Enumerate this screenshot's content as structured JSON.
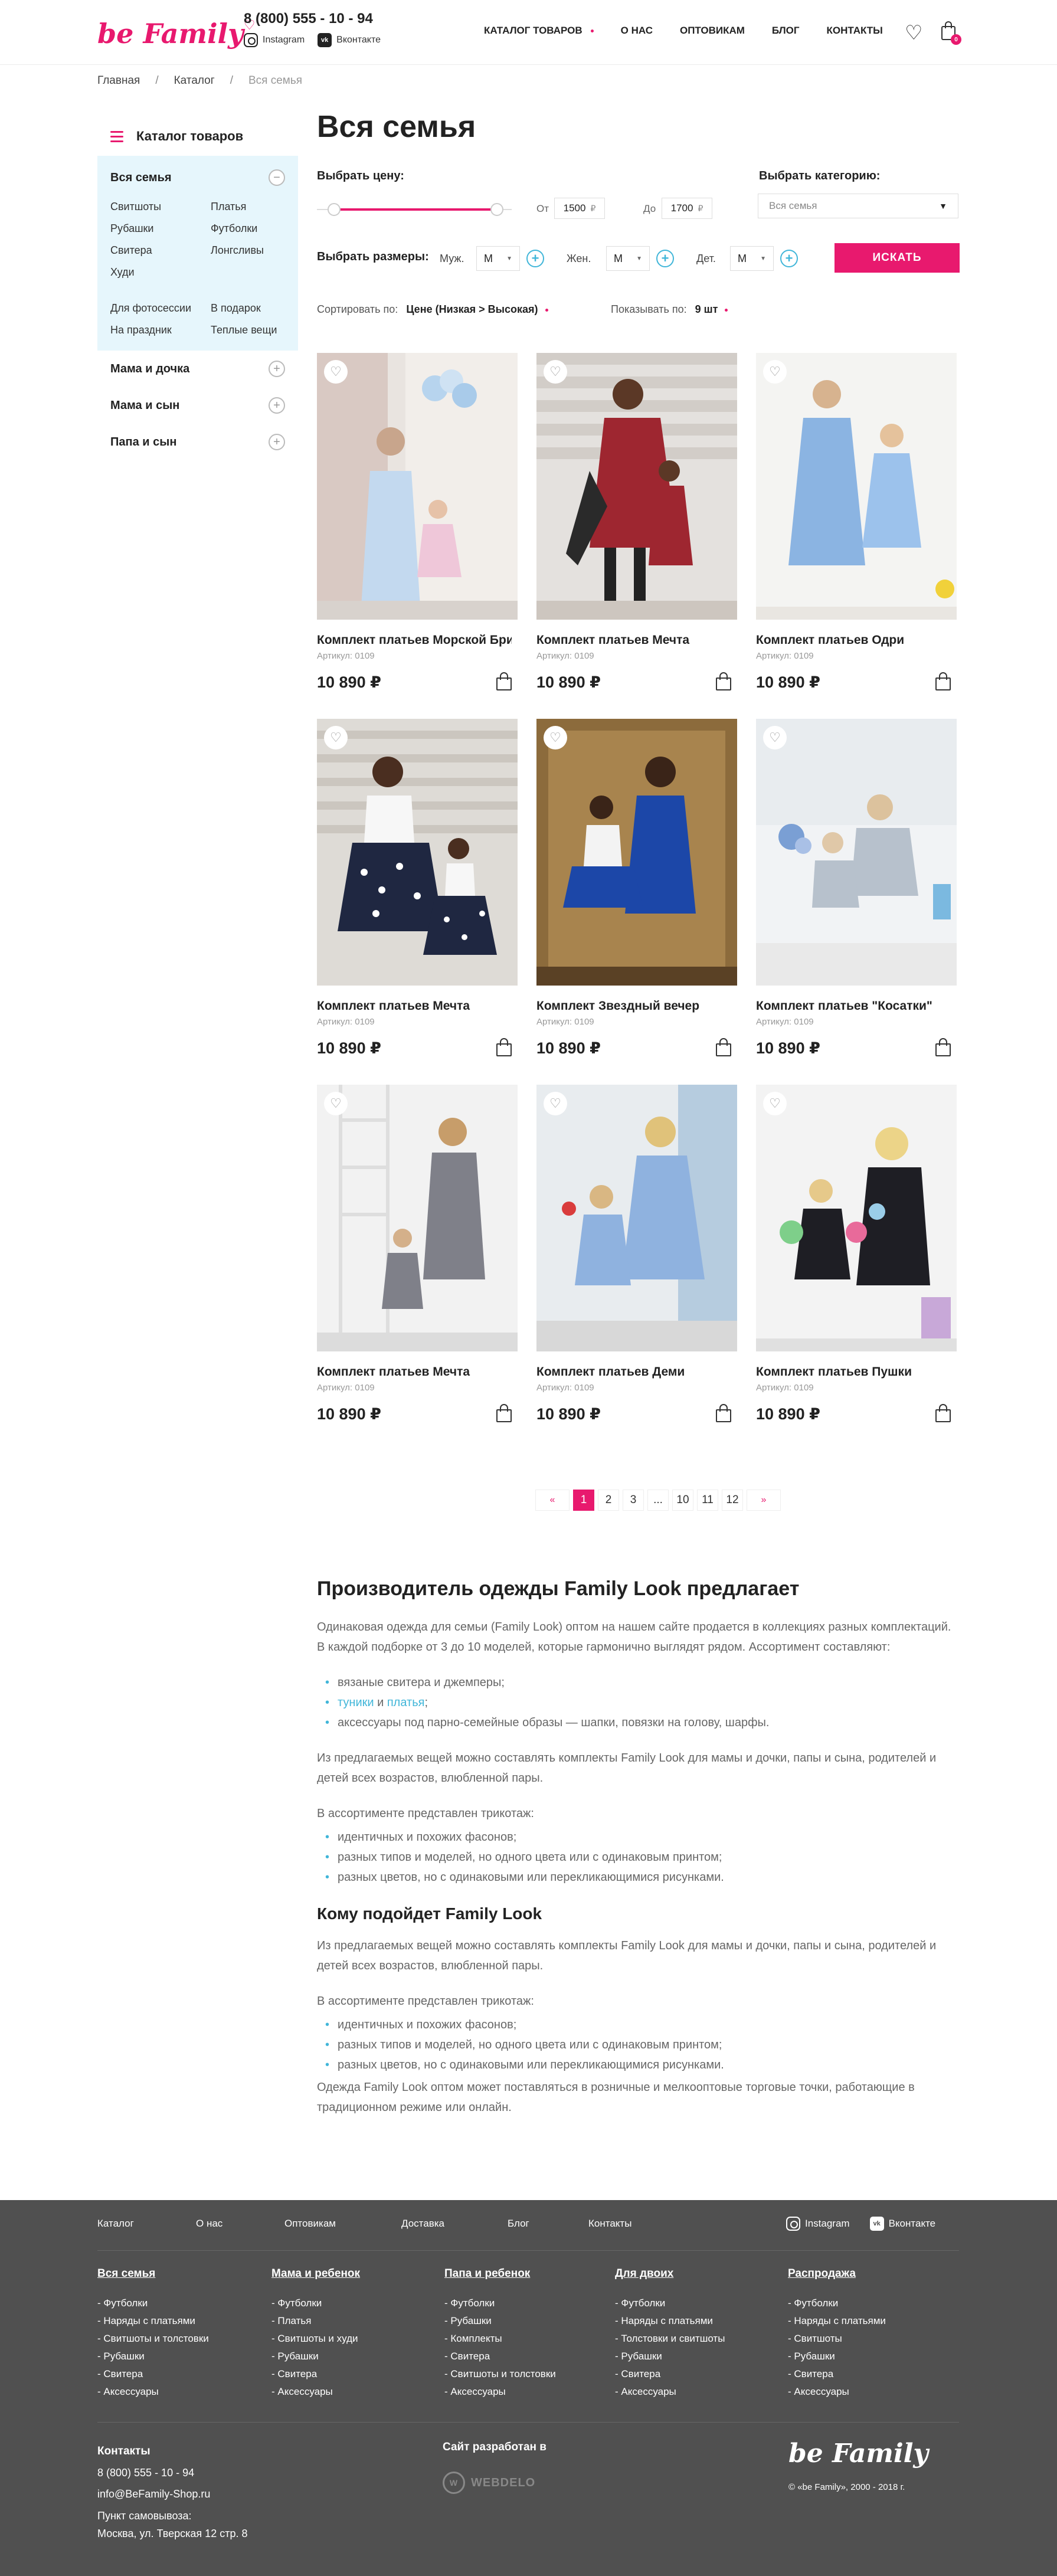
{
  "header": {
    "logo": "be Family",
    "phone": "8 (800) 555 - 10 - 94",
    "instagram": "Instagram",
    "vk": "Вконтакте",
    "nav": [
      "КАТАЛОГ ТОВАРОВ",
      "О НАС",
      "ОПТОВИКАМ",
      "БЛОГ",
      "КОНТАКТЫ"
    ],
    "cart_count": "0"
  },
  "breadcrumb": [
    "Главная",
    "Каталог",
    "Вся семья"
  ],
  "page_title": "Вся семья",
  "sidebar": {
    "heading": "Каталог товаров",
    "open_section": "Вся семья",
    "open_items_a": [
      "Свитшоты",
      "Платья",
      "Рубашки",
      "Футболки",
      "Свитера",
      "Лонгсливы",
      "Худи"
    ],
    "open_items_b": [
      "Для фотосессии",
      "В подарок",
      "На праздник",
      "Теплые вещи"
    ],
    "sections": [
      "Мама и дочка",
      "Мама и сын",
      "Папа и сын"
    ]
  },
  "filters": {
    "price_label": "Выбрать цену:",
    "from_label": "От",
    "from_value": "1500",
    "to_label": "До",
    "to_value": "1700",
    "currency": "₽",
    "category_label": "Выбрать категорию:",
    "category_value": "Вся семья",
    "size_label": "Выбрать размеры:",
    "men_label": "Муж.",
    "women_label": "Жен.",
    "kids_label": "Дет.",
    "size_value": "M",
    "search_button": "ИСКАТЬ",
    "sort_label": "Сортировать по:",
    "sort_value": "Цене (Низкая > Высокая)",
    "show_label": "Показывать по:",
    "show_value": "9 шт",
    "price_range_fraction": [
      0.08,
      0.92
    ]
  },
  "products": [
    {
      "name": "Комплект платьев Морской Бриз",
      "article": "Артикул: 0109",
      "price": "10 890 ₽"
    },
    {
      "name": "Комплект платьев Мечта",
      "article": "Артикул: 0109",
      "price": "10 890 ₽"
    },
    {
      "name": "Комплект платьев Одри",
      "article": "Артикул: 0109",
      "price": "10 890 ₽"
    },
    {
      "name": "Комплект платьев Мечта",
      "article": "Артикул: 0109",
      "price": "10 890 ₽"
    },
    {
      "name": "Комплект Звездный вечер",
      "article": "Артикул: 0109",
      "price": "10 890 ₽"
    },
    {
      "name": "Комплект платьев \"Косатки\"",
      "article": "Артикул: 0109",
      "price": "10 890 ₽"
    },
    {
      "name": "Комплект платьев Мечта",
      "article": "Артикул: 0109",
      "price": "10 890 ₽"
    },
    {
      "name": "Комплект платьев Деми",
      "article": "Артикул: 0109",
      "price": "10 890 ₽"
    },
    {
      "name": "Комплект платьев Пушки",
      "article": "Артикул: 0109",
      "price": "10 890 ₽"
    }
  ],
  "pagination": {
    "prev": "«",
    "pages": [
      "1",
      "2",
      "3",
      "...",
      "10",
      "11",
      "12"
    ],
    "next": "»",
    "active": "1"
  },
  "seo": {
    "h2": "Производитель одежды Family Look предлагает",
    "p1": "Одинаковая одежда для семьи (Family Look) оптом на нашем сайте продается в коллекциях разных комплектаций. В каждой подборке от 3 до 10 моделей, которые гармонично выглядят рядом. Ассортимент составляют:",
    "list1_a": "вязаные свитера и джемперы;",
    "list1_b_link1": "туники",
    "list1_b_and": " и ",
    "list1_b_link2": "платья",
    "list1_b_end": ";",
    "list1_c": "аксессуары под парно-семейные образы — шапки, повязки на голову, шарфы.",
    "p2": "Из предлагаемых вещей можно составлять комплекты Family Look для мамы и дочки, папы и сына, родителей и детей всех возрастов, влюбленной пары.",
    "p3": "В ассортименте представлен трикотаж:",
    "list2": [
      "идентичных и похожих фасонов;",
      "разных типов и моделей, но одного цвета или с одинаковым принтом;",
      "разных цветов, но с одинаковыми или перекликающимися рисунками."
    ],
    "h3": "Кому подойдет Family Look",
    "p4": "Из предлагаемых вещей можно составлять комплекты Family Look для мамы и дочки, папы и сына, родителей и детей всех возрастов, влюбленной пары.",
    "p5": "В ассортименте представлен трикотаж:",
    "list3": [
      "идентичных и похожих фасонов;",
      "разных типов и моделей, но одного цвета или с одинаковым принтом;",
      "разных цветов, но с одинаковыми или перекликающимися рисунками."
    ],
    "p6": "Одежда Family Look оптом может поставляться в розничные и мелкооптовые торговые точки, работающие в традиционном режиме или онлайн."
  },
  "footer": {
    "top_links": [
      "Каталог",
      "О нас",
      "Оптовикам",
      "Доставка",
      "Блог",
      "Контакты"
    ],
    "instagram": "Instagram",
    "vk": "Вконтакте",
    "columns": [
      {
        "title": "Вся семья",
        "items": [
          "Футболки",
          "Наряды с платьями",
          "Свитшоты и толстовки",
          "Рубашки",
          "Свитера",
          "Аксессуары"
        ]
      },
      {
        "title": "Мама и ребенок",
        "items": [
          "Футболки",
          "Платья",
          "Свитшоты и худи",
          "Рубашки",
          "Свитера",
          "Аксессуары"
        ]
      },
      {
        "title": "Папа и ребенок",
        "items": [
          "Футболки",
          "Рубашки",
          "Комплекты",
          "Свитера",
          "Свитшоты и толстовки",
          "Аксессуары"
        ]
      },
      {
        "title": "Для двоих",
        "items": [
          "Футболки",
          "Наряды с платьями",
          "Толстовки и свитшоты",
          "Рубашки",
          "Свитера",
          "Аксессуары"
        ]
      },
      {
        "title": "Распродажа",
        "items": [
          "Футболки",
          "Наряды с платьями",
          "Свитшоты",
          "Рубашки",
          "Свитера",
          "Аксессуары"
        ]
      }
    ],
    "contacts_title": "Контакты",
    "phone": "8 (800) 555 - 10 - 94",
    "email": "info@BeFamily-Shop.ru",
    "pickup_label": "Пункт самовывоза:",
    "pickup_address": "Москва, ул. Тверская 12 стр. 8",
    "dev_label": "Сайт разработан в",
    "dev_name": "WEBDELO",
    "logo": "be Family",
    "copyright": "© «be Family», 2000 - 2018 г."
  },
  "colors": {
    "accent": "#e8196e",
    "link": "#41b6d9",
    "footer_bg": "#505050",
    "sidebar_bg": "#e6f6fc"
  }
}
